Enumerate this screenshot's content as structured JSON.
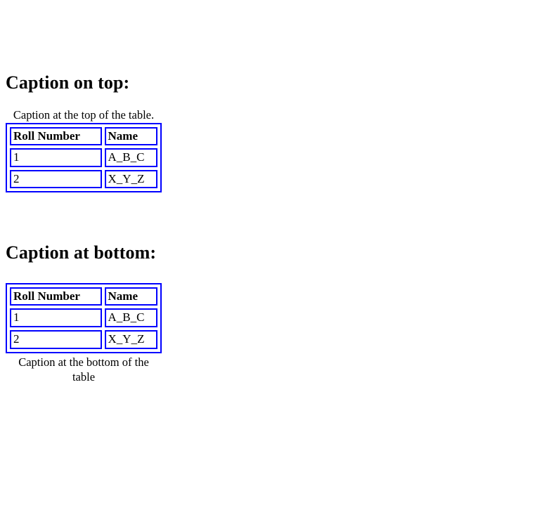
{
  "page": {
    "background_color": "#ffffff",
    "text_color": "#000000",
    "border_color": "#0000ff"
  },
  "sections": [
    {
      "heading": "Caption on top:",
      "caption_side": "top",
      "caption": "Caption at the top of the table.",
      "columns": [
        "Roll Number",
        "Name"
      ],
      "rows": [
        [
          "1",
          "A_B_C"
        ],
        [
          "2",
          "X_Y_Z"
        ]
      ]
    },
    {
      "heading": "Caption at bottom:",
      "caption_side": "bottom",
      "caption": "Caption at the bottom of the table",
      "columns": [
        "Roll Number",
        "Name"
      ],
      "rows": [
        [
          "1",
          "A_B_C"
        ],
        [
          "2",
          "X_Y_Z"
        ]
      ]
    }
  ]
}
